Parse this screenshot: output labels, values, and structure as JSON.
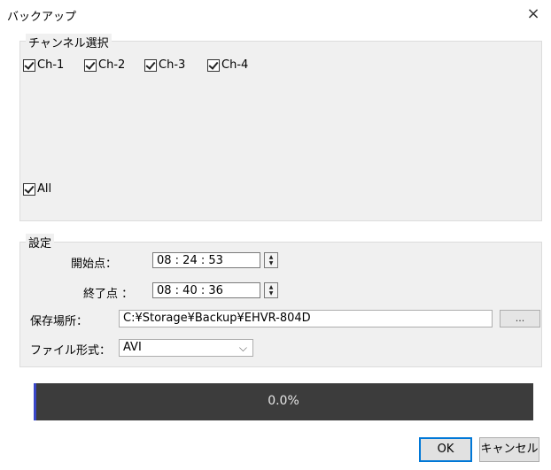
{
  "window": {
    "title": "バックアップ",
    "close_glyph": "×"
  },
  "channels": {
    "legend": "チャンネル選択",
    "items": [
      {
        "label": "Ch-1",
        "checked": true
      },
      {
        "label": "Ch-2",
        "checked": true
      },
      {
        "label": "Ch-3",
        "checked": true
      },
      {
        "label": "Ch-4",
        "checked": true
      }
    ],
    "all": {
      "label": "All",
      "checked": true
    }
  },
  "settings": {
    "legend": "設定",
    "start_label": "開始点：",
    "start_value": "08 : 24 : 53",
    "end_label": "終了点 ：",
    "end_value": "08 : 40 : 36",
    "location_label": "保存場所：",
    "location_value": "C:¥Storage¥Backup¥EHVR-804D",
    "browse_label": "...",
    "format_label": "ファイル形式：",
    "format_value": "AVI"
  },
  "progress": {
    "percent_text": "0.0%",
    "fill_fraction": 0.0,
    "accent": "#3a47c8"
  },
  "buttons": {
    "ok": "OK",
    "cancel": "キャンセル"
  }
}
